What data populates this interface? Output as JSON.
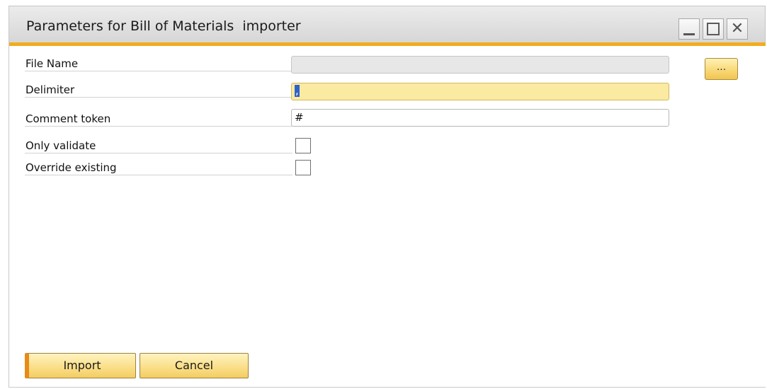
{
  "window": {
    "title": "Parameters for Bill of Materials  importer",
    "controls": {
      "minimize": "minimize-icon",
      "maximize": "maximize-icon",
      "close": "close-icon",
      "close_glyph": "✕"
    }
  },
  "form": {
    "file_name": {
      "label": "File Name",
      "value": ""
    },
    "browse_button": {
      "label": "..."
    },
    "delimiter": {
      "label": "Delimiter",
      "value": ","
    },
    "comment_token": {
      "label": "Comment token",
      "value": "#"
    },
    "only_validate": {
      "label": "Only validate",
      "checked": false
    },
    "override_existing": {
      "label": "Override existing",
      "checked": false
    }
  },
  "buttons": {
    "import_label": "Import",
    "cancel_label": "Cancel"
  },
  "colors": {
    "accent_orange": "#f2ad1d",
    "focused_field": "#fbeaa1",
    "button_gold": "#fadf8a"
  }
}
